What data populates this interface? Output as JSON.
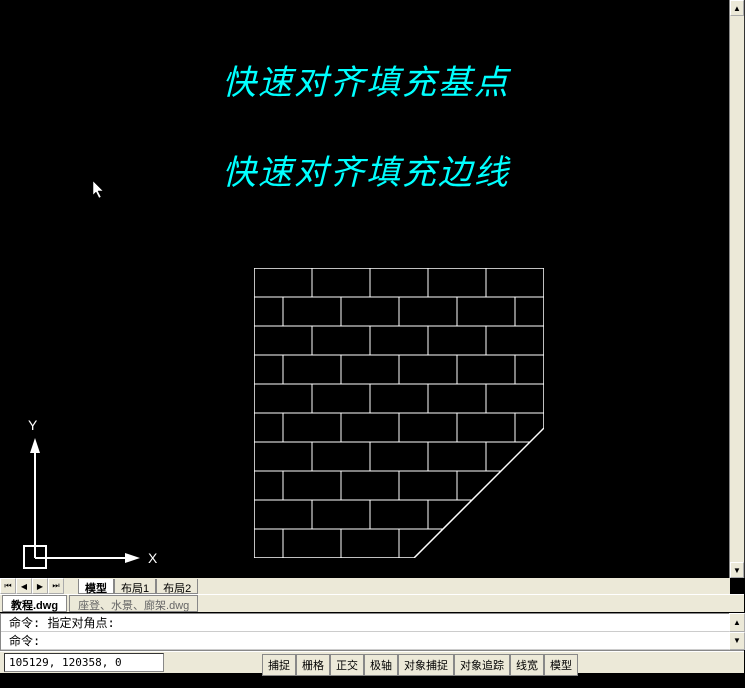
{
  "canvas": {
    "title1": "快速对齐填充基点",
    "title2": "快速对齐填充边线",
    "axis_x": "X",
    "axis_y": "Y"
  },
  "tabs": {
    "model_tabs": [
      "模型",
      "布局1",
      "布局2"
    ],
    "file_tabs": [
      {
        "label": "教程.dwg",
        "active": true
      },
      {
        "label": "座登、水景、廊架.dwg",
        "active": false
      }
    ]
  },
  "command": {
    "line1_prefix": "命令:",
    "line1_text": "指定对角点:",
    "line2_prefix": "命令:",
    "line2_text": ""
  },
  "status": {
    "coords": "105129, 120358, 0",
    "buttons": [
      "捕捉",
      "栅格",
      "正交",
      "极轴",
      "对象捕捉",
      "对象追踪",
      "线宽",
      "模型"
    ]
  }
}
